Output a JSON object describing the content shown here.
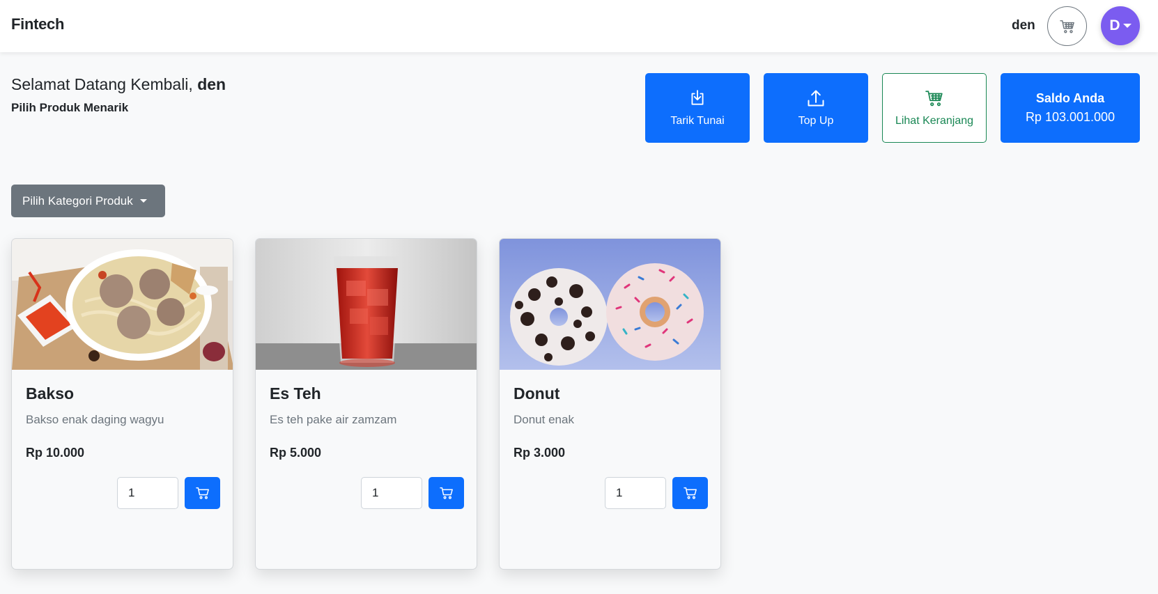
{
  "navbar": {
    "brand": "Fintech",
    "username": "den",
    "cart_icon": "cart-icon",
    "avatar_initial": "D"
  },
  "welcome": {
    "greeting": "Selamat Datang Kembali,",
    "name": "den",
    "subtitle": "Pilih Produk Menarik"
  },
  "actions": {
    "withdraw": {
      "label": "Tarik Tunai",
      "icon": "download-icon"
    },
    "topup": {
      "label": "Top Up",
      "icon": "upload-icon"
    },
    "cart": {
      "label": "Lihat Keranjang",
      "icon": "cart-icon"
    },
    "balance": {
      "title": "Saldo Anda",
      "value": "Rp 103.001.000"
    }
  },
  "category": {
    "label": "Pilih Kategori Produk"
  },
  "products": [
    {
      "name": "Bakso",
      "description": "Bakso enak daging wagyu",
      "price": "Rp 10.000",
      "qty": "1"
    },
    {
      "name": "Es Teh",
      "description": "Es teh pake air zamzam",
      "price": "Rp 5.000",
      "qty": "1"
    },
    {
      "name": "Donut",
      "description": "Donut enak",
      "price": "Rp 3.000",
      "qty": "1"
    }
  ],
  "colors": {
    "primary": "#0d6efd",
    "success": "#198754",
    "secondary": "#6c757d",
    "avatar": "#7b5cf0",
    "background": "#f8f9fa"
  }
}
